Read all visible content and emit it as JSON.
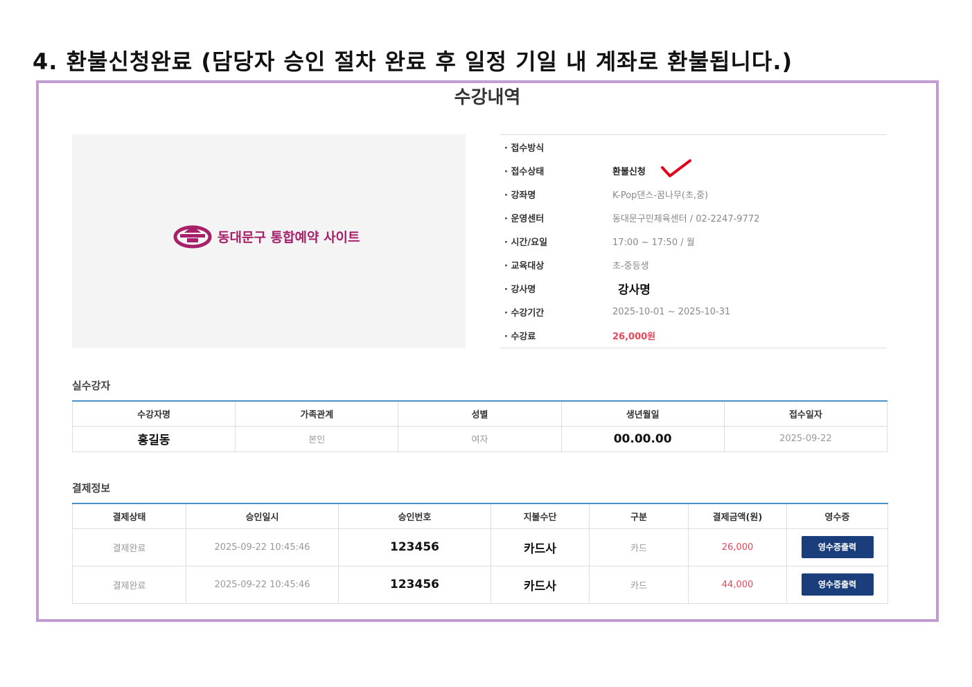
{
  "step_title": "4. 환불신청완료 (담당자 승인 절차 완료 후 일정 기일 내 계좌로 환불됩니다.)",
  "page_title": "수강내역",
  "logo_text": "동대문구 통합예약 사이트",
  "colors": {
    "frame": "#c39bd3",
    "brand": "#a6206a",
    "accent_red": "#e8465a",
    "button": "#1a3d7c",
    "table_top": "#4a90c8",
    "check": "#e3001b"
  },
  "info": [
    {
      "label": "· 접수방식",
      "value": ""
    },
    {
      "label": "· 접수상태",
      "value": "환불신청"
    },
    {
      "label": "· 강좌명",
      "value": "K-Pop댄스-꿈나무(초,중)"
    },
    {
      "label": "· 운영센터",
      "value": "동대문구민체육센터 / 02-2247-9772"
    },
    {
      "label": "· 시간/요일",
      "value": "17:00 ~ 17:50 / 월"
    },
    {
      "label": "· 교육대상",
      "value": "초-중등생"
    },
    {
      "label": "· 강사명",
      "value": "강사명"
    },
    {
      "label": "· 수강기간",
      "value": "2025-10-01 ~ 2025-10-31"
    },
    {
      "label": "· 수강료",
      "value": "26,000원"
    }
  ],
  "attendee": {
    "title": "실수강자",
    "headers": [
      "수강자명",
      "가족관계",
      "성별",
      "생년월일",
      "접수일자"
    ],
    "row": [
      "홍길동",
      "본인",
      "여자",
      "00.00.00",
      "2025-09-22"
    ]
  },
  "payment": {
    "title": "결제정보",
    "headers": [
      "결제상태",
      "승인일시",
      "승인번호",
      "지불수단",
      "구분",
      "결제금액(원)",
      "영수증"
    ],
    "rows": [
      [
        "결제완료",
        "2025-09-22 10:45:46",
        "123456",
        "카드사",
        "카드",
        "26,000"
      ],
      [
        "결제완료",
        "2025-09-22 10:45:46",
        "123456",
        "카드사",
        "카드",
        "44,000"
      ]
    ],
    "receipt_button": "영수증출력"
  }
}
